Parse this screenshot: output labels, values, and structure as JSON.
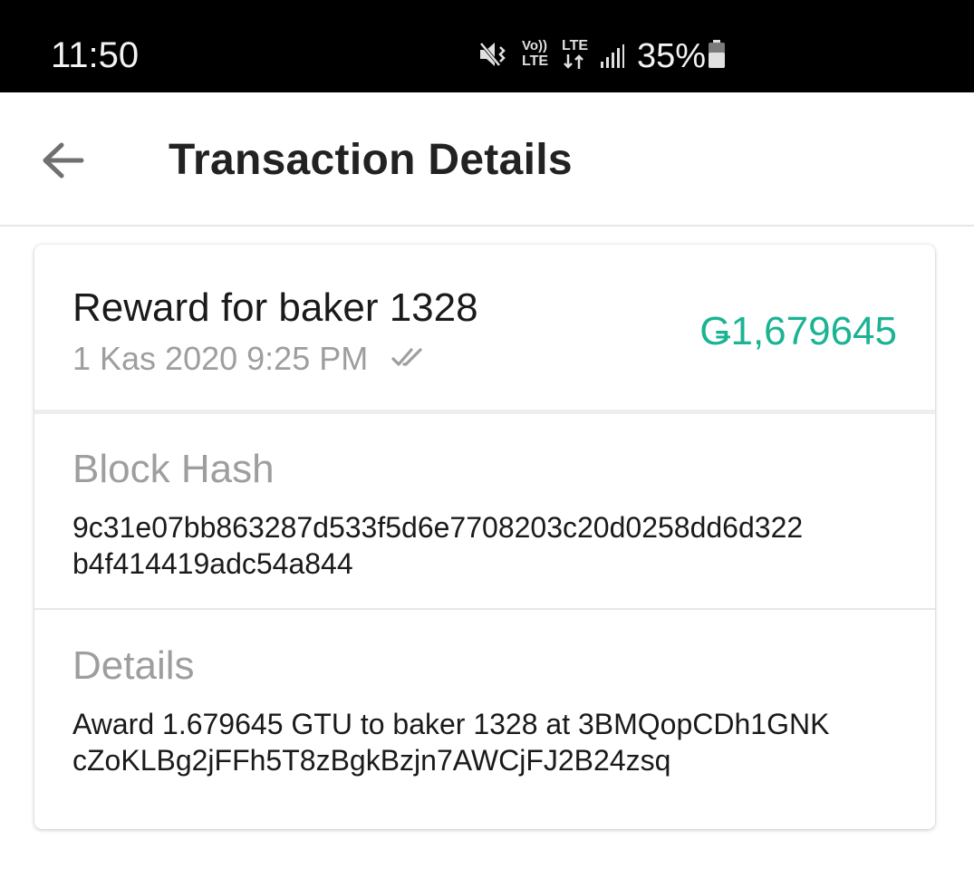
{
  "status_bar": {
    "time": "11:50",
    "battery_percent": "35%",
    "icons": [
      "mute-icon",
      "volte-icon",
      "lte-data-icon",
      "signal-icon",
      "battery-icon"
    ],
    "volte_label": "Vo))",
    "lte_label": "LTE"
  },
  "app_bar": {
    "title": "Transaction Details",
    "back_icon": "arrow-back-icon"
  },
  "transaction": {
    "title": "Reward for baker 1328",
    "date": "1 Kas 2020 9:25 PM",
    "status_icon": "double-check-icon",
    "amount": "Ǥ1,679645",
    "amount_color": "#1ab394"
  },
  "block_hash": {
    "label": "Block Hash",
    "line1": "9c31e07bb863287d533f5d6e7708203c20d0258dd6d322",
    "line2": "b4f414419adc54a844"
  },
  "details": {
    "label": "Details",
    "line1": "Award 1.679645 GTU to baker 1328 at 3BMQopCDh1GNK",
    "line2": "cZoKLBg2jFFh5T8zBgkBzjn7AWCjFJ2B24zsq"
  }
}
